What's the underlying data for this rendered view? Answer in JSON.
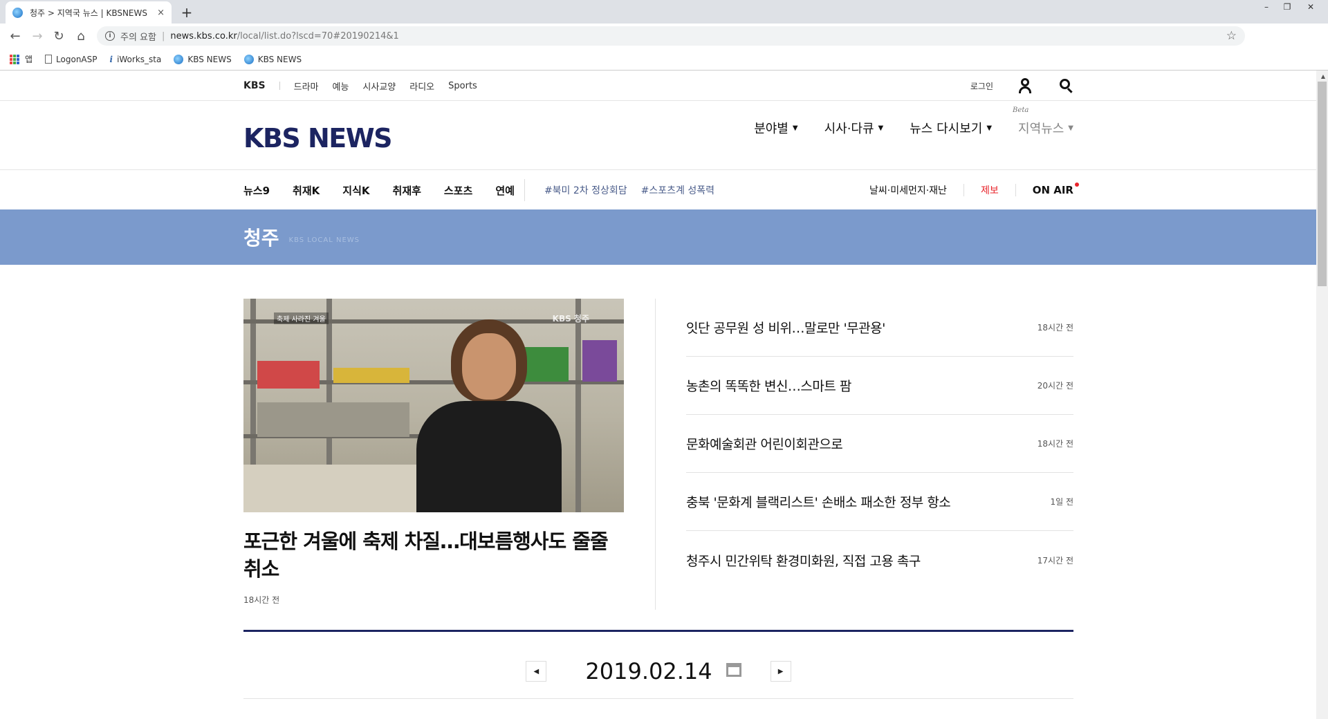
{
  "browser": {
    "tab_title": "청주 > 지역국 뉴스 | KBSNEWS",
    "tab_close": "×",
    "new_tab": "+",
    "win_min": "–",
    "win_max": "❐",
    "win_close": "✕",
    "security_label": "주의 요함",
    "url_host": "news.kbs.co.kr",
    "url_path": "/local/list.do?lscd=70#20190214&1",
    "bookmarks": [
      "앱",
      "LogonASP",
      "iWorks_sta",
      "KBS NEWS",
      "KBS NEWS"
    ]
  },
  "util": {
    "brand": "KBS",
    "categories": [
      "드라마",
      "예능",
      "시사교양",
      "라디오",
      "Sports"
    ],
    "login": "로그인"
  },
  "header": {
    "logo": "KBS NEWS",
    "nav": [
      "분야별",
      "시사·다큐",
      "뉴스 다시보기",
      "지역뉴스"
    ],
    "beta": "Beta"
  },
  "subnav": {
    "items": [
      "뉴스9",
      "취재K",
      "지식K",
      "취재후",
      "스포츠",
      "연예"
    ],
    "tags": [
      "#북미 2차 정상회담",
      "#스포츠계 성폭력"
    ],
    "weather": "날씨·미세먼지·재난",
    "report": "제보",
    "onair": "ON AIR"
  },
  "banner": {
    "region": "청주",
    "subtitle": "KBS LOCAL NEWS"
  },
  "feature": {
    "caption": "축제 사라진 겨울",
    "watermark": "KBS 청주",
    "title": "포근한 겨울에 축제 차질…대보름행사도 줄줄 취소",
    "time": "18시간 전"
  },
  "news_list": [
    {
      "title": "잇단 공무원 성 비위…말로만 '무관용'",
      "time": "18시간 전"
    },
    {
      "title": "농촌의 똑똑한 변신…스마트 팜",
      "time": "20시간 전"
    },
    {
      "title": "문화예술회관 어린이회관으로",
      "time": "18시간 전"
    },
    {
      "title": "충북 '문화계 블랙리스트' 손배소 패소한 정부 항소",
      "time": "1일 전"
    },
    {
      "title": "청주시 민간위탁 환경미화원, 직접 고용 촉구",
      "time": "17시간 전"
    }
  ],
  "date_nav": {
    "date": "2019.02.14"
  },
  "colors": {
    "banner": "#7b9acc",
    "logo": "#1c2461",
    "accent_red": "#e8242b"
  }
}
